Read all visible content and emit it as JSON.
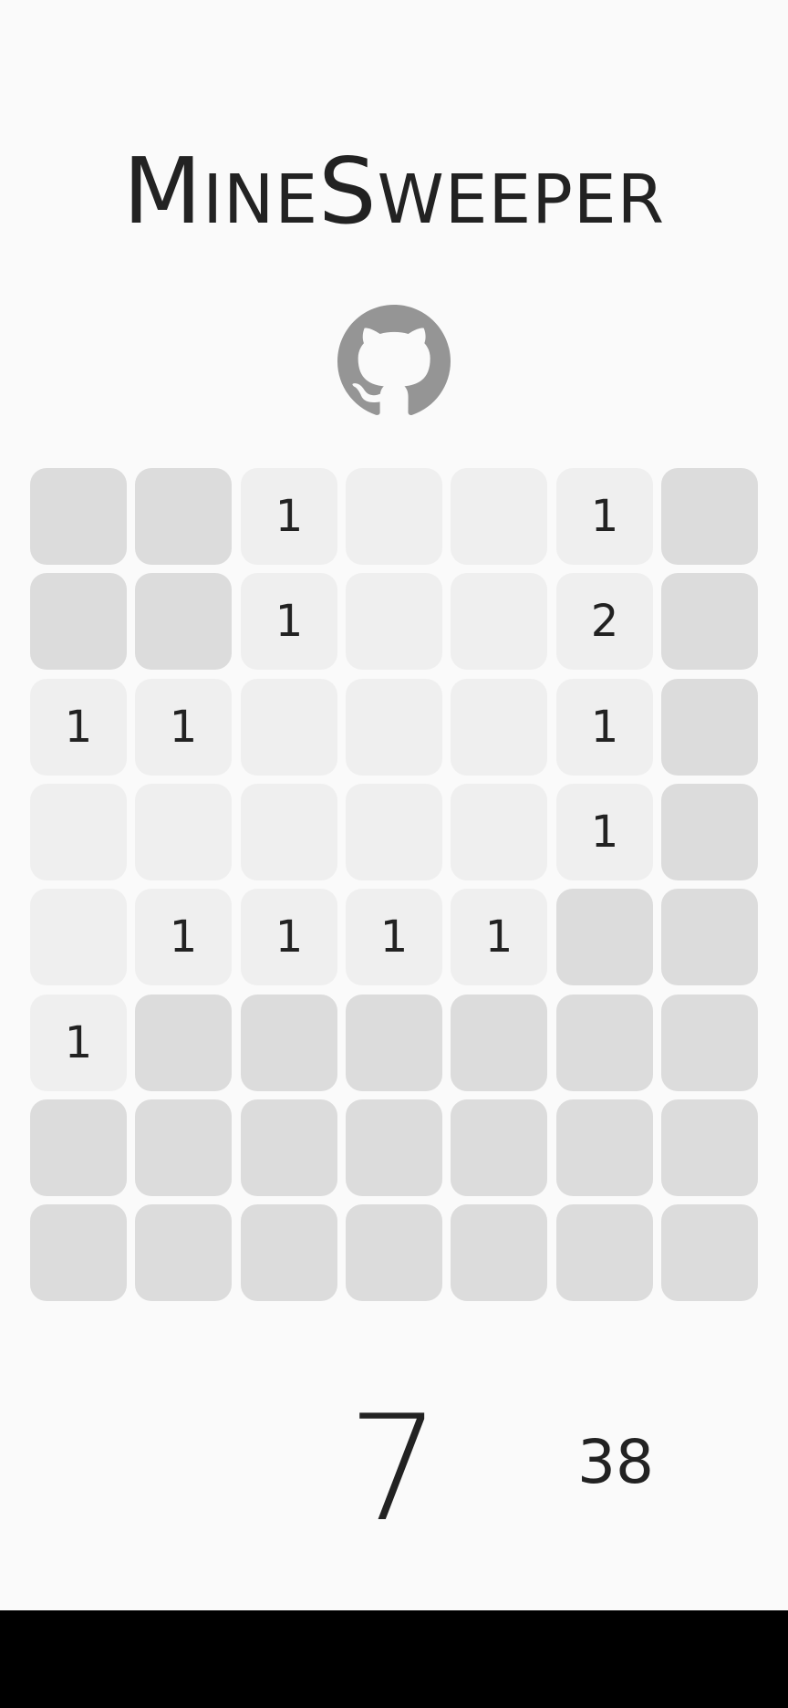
{
  "title": {
    "first_big": "M",
    "first_rest": "INE",
    "second_big": "S",
    "second_rest": "WEEPER"
  },
  "github": {
    "icon": "github-icon"
  },
  "board": {
    "rows": 8,
    "cols": 7,
    "cells": [
      [
        {
          "open": false,
          "value": ""
        },
        {
          "open": false,
          "value": ""
        },
        {
          "open": true,
          "value": "1"
        },
        {
          "open": true,
          "value": ""
        },
        {
          "open": true,
          "value": ""
        },
        {
          "open": true,
          "value": "1"
        },
        {
          "open": false,
          "value": ""
        }
      ],
      [
        {
          "open": false,
          "value": ""
        },
        {
          "open": false,
          "value": ""
        },
        {
          "open": true,
          "value": "1"
        },
        {
          "open": true,
          "value": ""
        },
        {
          "open": true,
          "value": ""
        },
        {
          "open": true,
          "value": "2"
        },
        {
          "open": false,
          "value": ""
        }
      ],
      [
        {
          "open": true,
          "value": "1"
        },
        {
          "open": true,
          "value": "1"
        },
        {
          "open": true,
          "value": ""
        },
        {
          "open": true,
          "value": ""
        },
        {
          "open": true,
          "value": ""
        },
        {
          "open": true,
          "value": "1"
        },
        {
          "open": false,
          "value": ""
        }
      ],
      [
        {
          "open": true,
          "value": ""
        },
        {
          "open": true,
          "value": ""
        },
        {
          "open": true,
          "value": ""
        },
        {
          "open": true,
          "value": ""
        },
        {
          "open": true,
          "value": ""
        },
        {
          "open": true,
          "value": "1"
        },
        {
          "open": false,
          "value": ""
        }
      ],
      [
        {
          "open": true,
          "value": ""
        },
        {
          "open": true,
          "value": "1"
        },
        {
          "open": true,
          "value": "1"
        },
        {
          "open": true,
          "value": "1"
        },
        {
          "open": true,
          "value": "1"
        },
        {
          "open": false,
          "value": ""
        },
        {
          "open": false,
          "value": ""
        }
      ],
      [
        {
          "open": true,
          "value": "1"
        },
        {
          "open": false,
          "value": ""
        },
        {
          "open": false,
          "value": ""
        },
        {
          "open": false,
          "value": ""
        },
        {
          "open": false,
          "value": ""
        },
        {
          "open": false,
          "value": ""
        },
        {
          "open": false,
          "value": ""
        }
      ],
      [
        {
          "open": false,
          "value": ""
        },
        {
          "open": false,
          "value": ""
        },
        {
          "open": false,
          "value": ""
        },
        {
          "open": false,
          "value": ""
        },
        {
          "open": false,
          "value": ""
        },
        {
          "open": false,
          "value": ""
        },
        {
          "open": false,
          "value": ""
        }
      ],
      [
        {
          "open": false,
          "value": ""
        },
        {
          "open": false,
          "value": ""
        },
        {
          "open": false,
          "value": ""
        },
        {
          "open": false,
          "value": ""
        },
        {
          "open": false,
          "value": ""
        },
        {
          "open": false,
          "value": ""
        },
        {
          "open": false,
          "value": ""
        }
      ]
    ]
  },
  "status": {
    "timer": "7",
    "mines_left": "38"
  },
  "colors": {
    "closed": "#dcdcdc",
    "open": "#efefef",
    "text": "#222222",
    "icon": "#959595",
    "background": "#fafafa"
  }
}
